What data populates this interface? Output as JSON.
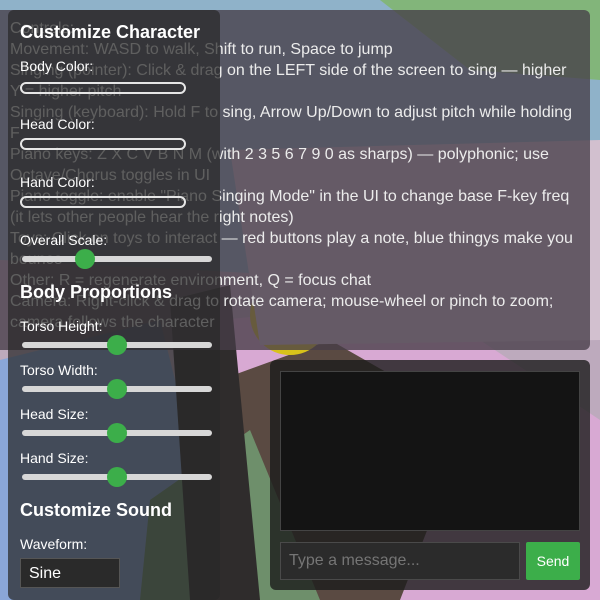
{
  "help": {
    "title": "Controls:",
    "lines": [
      "Movement: WASD to walk, Shift to run, Space to jump",
      "Singing (pointer): Click & drag on the LEFT side of the screen to sing — higher Y = higher pitch",
      "Singing (keyboard): Hold F to sing, Arrow Up/Down to adjust pitch while holding F",
      "Piano keys: Z X C V B N M (with 2 3 5 6 7 9 0 as sharps) — polyphonic; use Octave/Chorus toggles in UI",
      "Piano toggle: enable \"Piano Singing Mode\" in the UI to change base F-key freq (it lets other people hear the right notes)",
      "Toys: Click on toys to interact — red buttons play a note, blue thingys make you bounce",
      "Other: R = regenerate environment, Q = focus chat",
      "Camera: Right-click & drag to rotate camera; mouse-wheel or pinch to zoom; camera follows the character"
    ]
  },
  "panel": {
    "title": "Customize Character",
    "body_color_label": "Body Color:",
    "head_color_label": "Head Color:",
    "hand_color_label": "Hand Color:",
    "overall_scale_label": "Overall Scale:",
    "overall_scale_value": 0.33,
    "body_proportions_title": "Body Proportions",
    "torso_height_label": "Torso Height:",
    "torso_height_value": 0.5,
    "torso_width_label": "Torso Width:",
    "torso_width_value": 0.5,
    "head_size_label": "Head Size:",
    "head_size_value": 0.5,
    "hand_size_label": "Hand Size:",
    "hand_size_value": 0.5,
    "sound_title": "Customize Sound",
    "waveform_label": "Waveform:",
    "waveform_value": "Sine"
  },
  "chat": {
    "placeholder": "Type a message...",
    "send_label": "Send"
  },
  "colors": {
    "accent": "#3cae4a"
  }
}
